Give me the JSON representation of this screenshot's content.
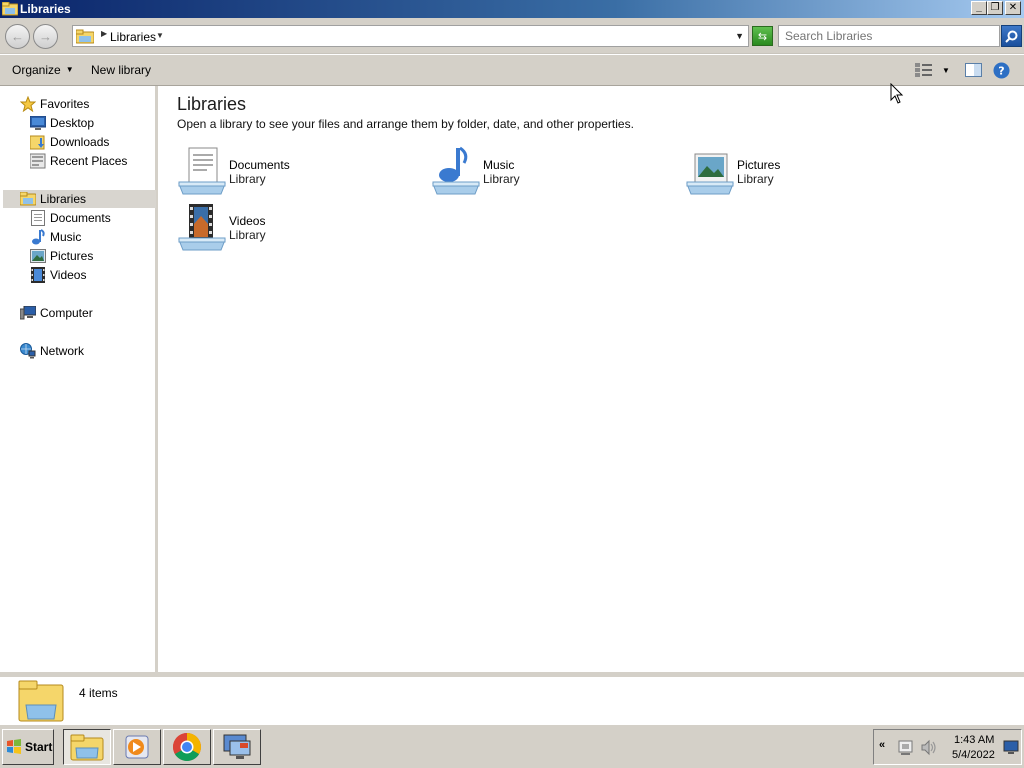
{
  "window": {
    "title": "Libraries",
    "minimize": "_",
    "restore": "❐",
    "close": "✕"
  },
  "address": {
    "crumb": "Libraries",
    "search_placeholder": "Search Libraries"
  },
  "toolbar": {
    "organize_label": "Organize",
    "new_library_label": "New library"
  },
  "nav": {
    "favorites": "Favorites",
    "desktop": "Desktop",
    "downloads": "Downloads",
    "recent_places": "Recent Places",
    "libraries": "Libraries",
    "documents": "Documents",
    "music": "Music",
    "pictures": "Pictures",
    "videos": "Videos",
    "computer": "Computer",
    "network": "Network"
  },
  "content": {
    "title": "Libraries",
    "subtitle": "Open a library to see your files and arrange them by folder, date, and other properties.",
    "libraries": [
      {
        "name": "Documents",
        "type": "Library",
        "icon": "documents-library-icon"
      },
      {
        "name": "Music",
        "type": "Library",
        "icon": "music-library-icon"
      },
      {
        "name": "Pictures",
        "type": "Library",
        "icon": "pictures-library-icon"
      },
      {
        "name": "Videos",
        "type": "Library",
        "icon": "videos-library-icon"
      }
    ]
  },
  "details": {
    "item_count": "4 items"
  },
  "taskbar": {
    "start_label": "Start",
    "time": "1:43 AM",
    "date": "5/4/2022",
    "tray_expand": "«"
  },
  "colors": {
    "chrome": "#d4d0c8",
    "titlebar_start": "#0a246a",
    "titlebar_end": "#a6caf0",
    "selection": "#d8d5cf"
  }
}
